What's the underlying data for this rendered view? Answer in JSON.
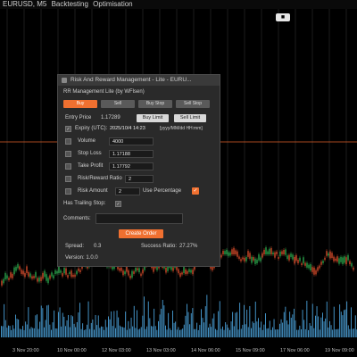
{
  "topbar": {
    "symbol": "EURUSD, M5",
    "menu": [
      "Backtesting",
      "Optimisation"
    ]
  },
  "colors": {
    "background": "#000000",
    "grid": "#1c1c1c",
    "price_line": "#e0602a",
    "bull": "#2aa34a",
    "bear": "#d44a2a",
    "volume": "#4aa0d8",
    "accent": "#f07030"
  },
  "chart_axis": {
    "x_labels": [
      "3 Nov 20:00",
      "10 Nov 00:00",
      "12 Nov 03:00",
      "13 Nov 03:00",
      "14 Nov 06:00",
      "15 Nov 09:00",
      "17 Nov 06:00",
      "19 Nov 09:00"
    ]
  },
  "dialog": {
    "title": "Risk And Reward Management - Lite - EURU...",
    "subtitle": "RR Management Lite (by WFlsen)",
    "tabs": [
      "Buy",
      "Sell",
      "Buy Stop",
      "Sell Stop"
    ],
    "active_tab": "Buy",
    "entry_price_label": "Entry Price",
    "entry_price_value": "1.17289",
    "buy_limit": "Buy Limit",
    "sell_limit": "Sell Limit",
    "expiry_label": "Expiry (UTC):",
    "expiry_value": "2025/10/4 14:23",
    "expiry_format": "[yyyy/MM/dd HH:mm]",
    "volume_label": "Volume",
    "volume_value": "4000",
    "stop_loss_label": "Stop Loss",
    "stop_loss_value": "1.17188",
    "take_profit_label": "Take Profit",
    "take_profit_value": "1.17792",
    "rr_ratio_label": "Risk/Reward Ratio",
    "rr_ratio_value": "2",
    "risk_amount_label": "Risk Amount",
    "risk_amount_value": "2",
    "use_percentage_label": "Use Percentage",
    "has_trailing_label": "Has Trailing Stop:",
    "comments_label": "Comments:",
    "comments_value": "",
    "create_order": "Create Order",
    "spread_label": "Spread:",
    "spread_value": "0.3",
    "success_label": "Success Ratio:",
    "success_value": "27.27%",
    "version": "Version: 1.0.0"
  }
}
